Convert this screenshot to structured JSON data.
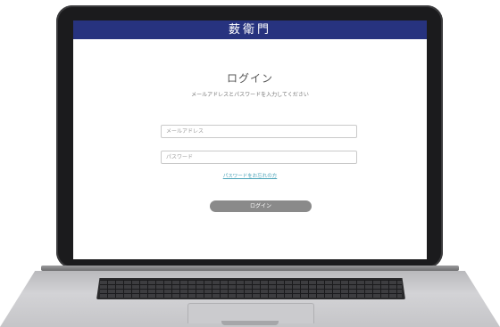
{
  "header": {
    "brand": "薮衛門"
  },
  "login": {
    "title": "ログイン",
    "subtitle": "メールアドレスとパスワードを入力してください",
    "email_placeholder": "メールアドレス",
    "password_placeholder": "パスワード",
    "forgot_link": "パスワードをお忘れの方",
    "submit_label": "ログイン"
  },
  "colors": {
    "header_bg": "#27337f",
    "button_bg": "#8a8a8a",
    "link": "#4aa3b8"
  }
}
